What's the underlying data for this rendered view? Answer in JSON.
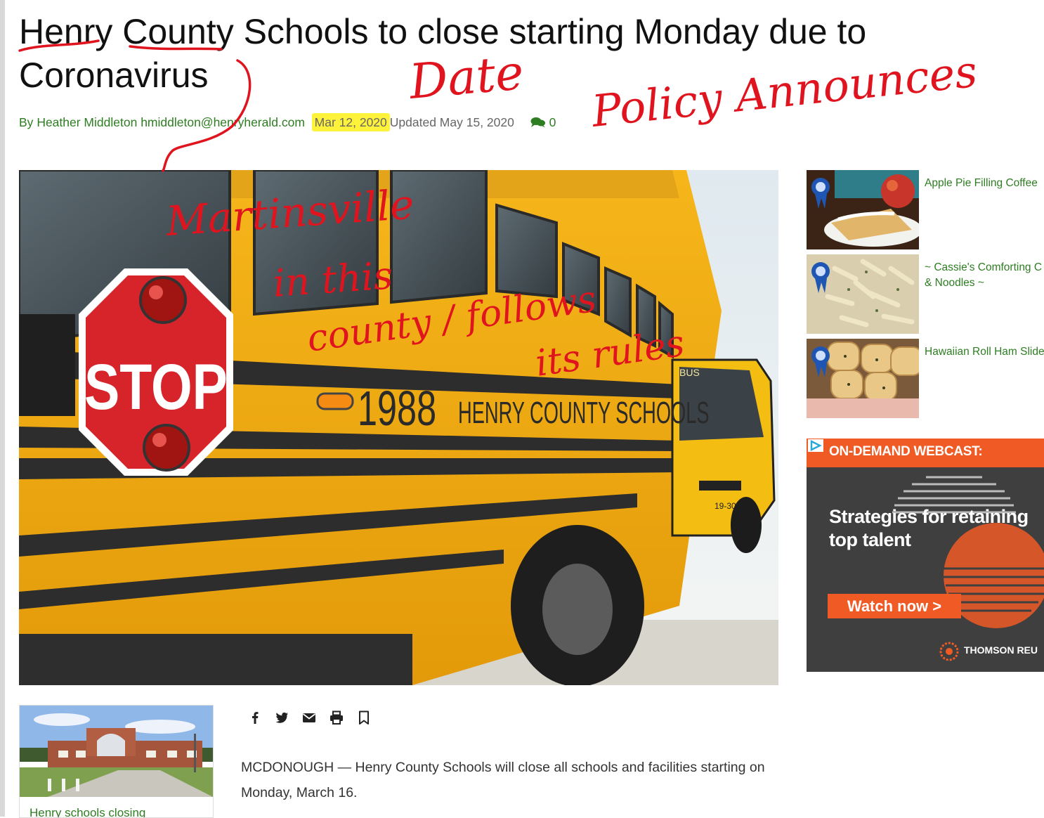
{
  "article": {
    "headline": "Henry County Schools to close starting Monday due to Coronavirus",
    "byline": {
      "prefix": "By",
      "author": "Heather Middleton",
      "email": "hmiddleton@henryherald.com",
      "date": "Mar 12, 2020",
      "updated": "Updated May 15, 2020",
      "comment_count": "0"
    },
    "body": "MCDONOUGH — Henry County Schools will close all schools and facilities starting on Monday, March 16."
  },
  "hero_image": {
    "stop_sign_text": "STOP",
    "bus_number": "1988",
    "bus_lettering": "HENRY COUNTY SCHOOLS",
    "second_bus_sign": "BUS",
    "second_bus_number": "19-30"
  },
  "sidebar": {
    "items": [
      {
        "label": "Apple Pie Filling Coffee"
      },
      {
        "label": "~ Cassie's Comforting C & Noodles ~"
      },
      {
        "label": "Hawaiian Roll Ham Slide"
      }
    ]
  },
  "ad": {
    "bar_label": "ON-DEMAND WEBCAST:",
    "headline": "Strategies for retaining top talent",
    "cta": "Watch now >",
    "brand": "THOMSON REU",
    "colors": {
      "accent": "#f05a24",
      "background": "#3f3f3f"
    }
  },
  "related": {
    "title": "Henry schools closing"
  },
  "share_icons": [
    "facebook-icon",
    "twitter-icon",
    "email-icon",
    "print-icon",
    "bookmark-icon"
  ],
  "annotations": {
    "date_note": "Date",
    "policy_note": "Policy Announces",
    "martinsville_note_line1": "Martinsville",
    "martinsville_note_line2": "in this",
    "martinsville_note_line3": "county / follows",
    "martinsville_note_line4": "its rules",
    "ink_color": "#e0141e",
    "highlight_color": "#fff23a"
  },
  "colors": {
    "link_green": "#2e7d22"
  }
}
